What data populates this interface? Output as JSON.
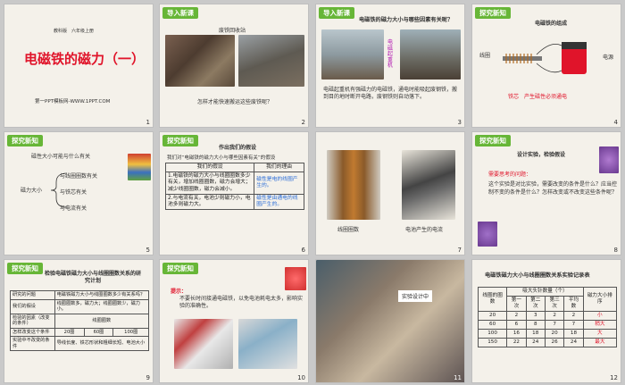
{
  "slides": [
    {
      "num": "1",
      "publisher": "教科版　六年级上册",
      "title": "电磁铁的磁力（一）",
      "footer": "第一PPT模板网-WWW.1PPT.COM"
    },
    {
      "num": "2",
      "tag": "导入新课",
      "caption": "废铁回收站",
      "question": "怎样才能快速搬运这些废铁呢？"
    },
    {
      "num": "3",
      "tag": "导入新课",
      "title": "电磁铁的磁力大小与哪些因素有关呢？",
      "side_label": "电磁起重机",
      "body": "电磁起重机有强磁力的电磁铁，通电时能吸起废钢铁，搬到目的地时断开电路，废钢铁则自动落下。"
    },
    {
      "num": "4",
      "tag": "探究新知",
      "title": "电磁铁的组成",
      "label_coil": "线圈",
      "label_power": "电源",
      "core_note": "铁芯　产生磁性必须通电"
    },
    {
      "num": "5",
      "tag": "探究新知",
      "question": "磁性大小可能与什么有关",
      "center": "磁力大小",
      "branches": [
        "与线圈圈数有关",
        "与铁芯有关",
        "与电流有关"
      ]
    },
    {
      "num": "6",
      "tag": "探究新知",
      "title": "作出我们的假设",
      "subtitle": "我们对“电磁铁的磁力大小与哪些因素有关”的假设",
      "col_hyp": "我们的假设",
      "col_reason": "我们的理由",
      "rows": [
        {
          "hyp": "1.电磁铁的磁力大小与线圈圈数多少有关，增加线圈圈数，磁力会增大；减少线圈圈数，磁力会减小。",
          "reason": "磁性是电的线圈产生的。"
        },
        {
          "hyp": "2.与电流有关，电池少则磁力小，电池多则磁力大。",
          "reason": "磁性是由通电的线圈产生的。"
        }
      ]
    },
    {
      "num": "7",
      "caption_left": "线圈圈数",
      "caption_right": "电池产生的电流"
    },
    {
      "num": "8",
      "tag": "探究新知",
      "title": "设计实验，检验假设",
      "prompt": "需要思考的问题：",
      "body": "这个实验是对比实验，需要改变的条件是什么？应当控制不变的条件是什么？怎样改变或不改变这些条件呢？"
    },
    {
      "num": "9",
      "tag": "探究新知",
      "title": "检验电磁铁磁力大小与线圈圈数关系的研究计划",
      "rows": [
        {
          "k": "研究的问题",
          "v": "电磁铁磁力大小与线圈圈数多少有关系吗？"
        },
        {
          "k": "我们的假设",
          "v": "线圈圈数多，磁力大；线圈圈数少，磁力小。"
        },
        {
          "k": "检验的因素（改变的条件）",
          "v": "线圈圈数"
        },
        {
          "k": "怎样改变这个条件",
          "v": ""
        },
        {
          "k": "实验中不改变的条件",
          "v": "导线长度、铁芯形状和粗细长短、电池大小"
        }
      ],
      "turns": [
        "20圈",
        "60圈",
        "100圈"
      ]
    },
    {
      "num": "10",
      "tag": "探究新知",
      "hint_label": "提示：",
      "hint": "不要长时间接通电磁铁，以免电池耗电太多，影响实验的准确性。"
    },
    {
      "num": "11",
      "caption": "实验设计中"
    },
    {
      "num": "12",
      "title": "电磁铁磁力大小与线圈圈数关系实验记录表",
      "h_turns": "线圈的圈数",
      "h_count": "吸大头针数量（个）",
      "h_trials": [
        "第一次",
        "第二次",
        "第三次",
        "平均数"
      ],
      "h_rank": "磁力大小排序",
      "rows": [
        {
          "n": "20",
          "v": [
            "2",
            "3",
            "2",
            "2"
          ],
          "r": "小"
        },
        {
          "n": "60",
          "v": [
            "6",
            "8",
            "7",
            "7"
          ],
          "r": "稍大"
        },
        {
          "n": "100",
          "v": [
            "16",
            "18",
            "20",
            "18"
          ],
          "r": "大"
        },
        {
          "n": "150",
          "v": [
            "22",
            "24",
            "26",
            "24"
          ],
          "r": "最大"
        }
      ]
    }
  ],
  "colors": {
    "accent": "#67b637",
    "title_red": "#e0142a",
    "reason_blue": "#2e6fd8",
    "warn_red": "#e0142a"
  }
}
